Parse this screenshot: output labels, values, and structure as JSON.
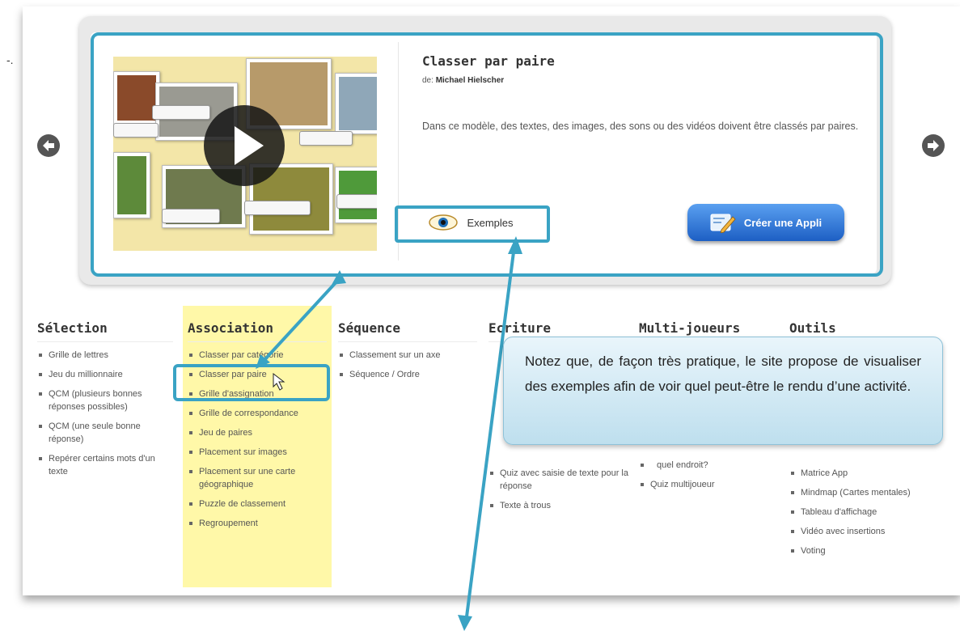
{
  "app": {
    "title": "Classer par paire",
    "author_prefix": "de:",
    "author": "Michael Hielscher",
    "description": "Dans ce modèle, des textes, des images, des sons ou des vidéos doivent être classés par paires.",
    "examples_label": "Exemples",
    "create_label": "Créer une Appli"
  },
  "preview": {
    "icon": "play-icon"
  },
  "nav": {
    "prev_icon": "arrow-left-icon",
    "next_icon": "arrow-right-icon"
  },
  "annotation": {
    "tooltip": "Notez que, de façon très pratique, le site propose de visualiser des exemples afin de voir quel peut-être le rendu d’une activité.",
    "accent_color": "#3aa3c4"
  },
  "stray_mark": "-.",
  "categories": [
    {
      "title": "Sélection",
      "items": [
        "Grille de lettres",
        "Jeu du millionnaire",
        "QCM (plusieurs bonnes réponses possibles)",
        "QCM (une seule bonne réponse)",
        "Repérer certains mots d'un texte"
      ]
    },
    {
      "title": "Association",
      "items": [
        "Classer par catégorie",
        "Classer par paire",
        "Grille d'assignation",
        "Grille de correspondance",
        "Jeu de paires",
        "Placement sur images",
        "Placement sur une carte géographique",
        "Puzzle de classement",
        "Regroupement"
      ]
    },
    {
      "title": "Séquence",
      "items": [
        "Classement sur un axe",
        "Séquence / Ordre"
      ]
    },
    {
      "title": "Ecriture",
      "items": [
        "",
        "",
        "",
        "Quiz avec saisie de texte pour la réponse",
        "Texte à trous"
      ]
    },
    {
      "title": "Multi-joueurs",
      "items": [
        "",
        "",
        "",
        "quel endroit?",
        "Quiz multijoueur"
      ]
    },
    {
      "title": "Outils",
      "items": [
        "",
        "",
        "",
        "Matrice App",
        "Mindmap (Cartes mentales)",
        "Tableau d'affichage",
        "Vidéo avec insertions",
        "Voting"
      ]
    }
  ],
  "colors": {
    "highlight_column": "#fff8a8",
    "create_button": "#2a73d6"
  }
}
